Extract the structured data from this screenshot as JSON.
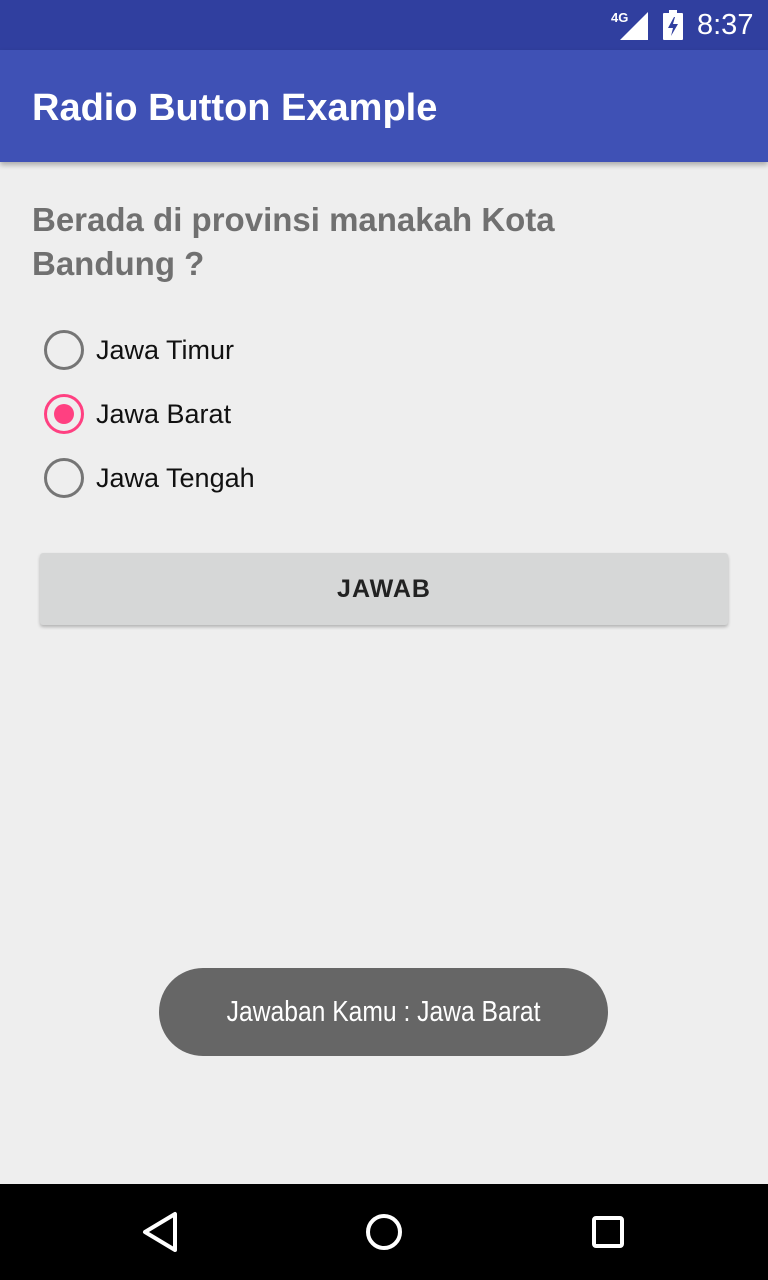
{
  "status_bar": {
    "network": "4G",
    "time": "8:37"
  },
  "app_bar": {
    "title": "Radio Button Example"
  },
  "question": "Berada di provinsi manakah Kota Bandung ?",
  "options": [
    {
      "label": "Jawa Timur",
      "checked": false
    },
    {
      "label": "Jawa Barat",
      "checked": true
    },
    {
      "label": "Jawa Tengah",
      "checked": false
    }
  ],
  "answer_button": {
    "label": "JAWAB"
  },
  "toast": {
    "message": "Jawaban Kamu : Jawa Barat"
  },
  "colors": {
    "status_bar": "#303f9f",
    "app_bar": "#3f51b5",
    "accent": "#ff4081",
    "background": "#eeeeee"
  },
  "nav_bar": {
    "icons": [
      "back-icon",
      "home-icon",
      "recents-icon"
    ]
  }
}
